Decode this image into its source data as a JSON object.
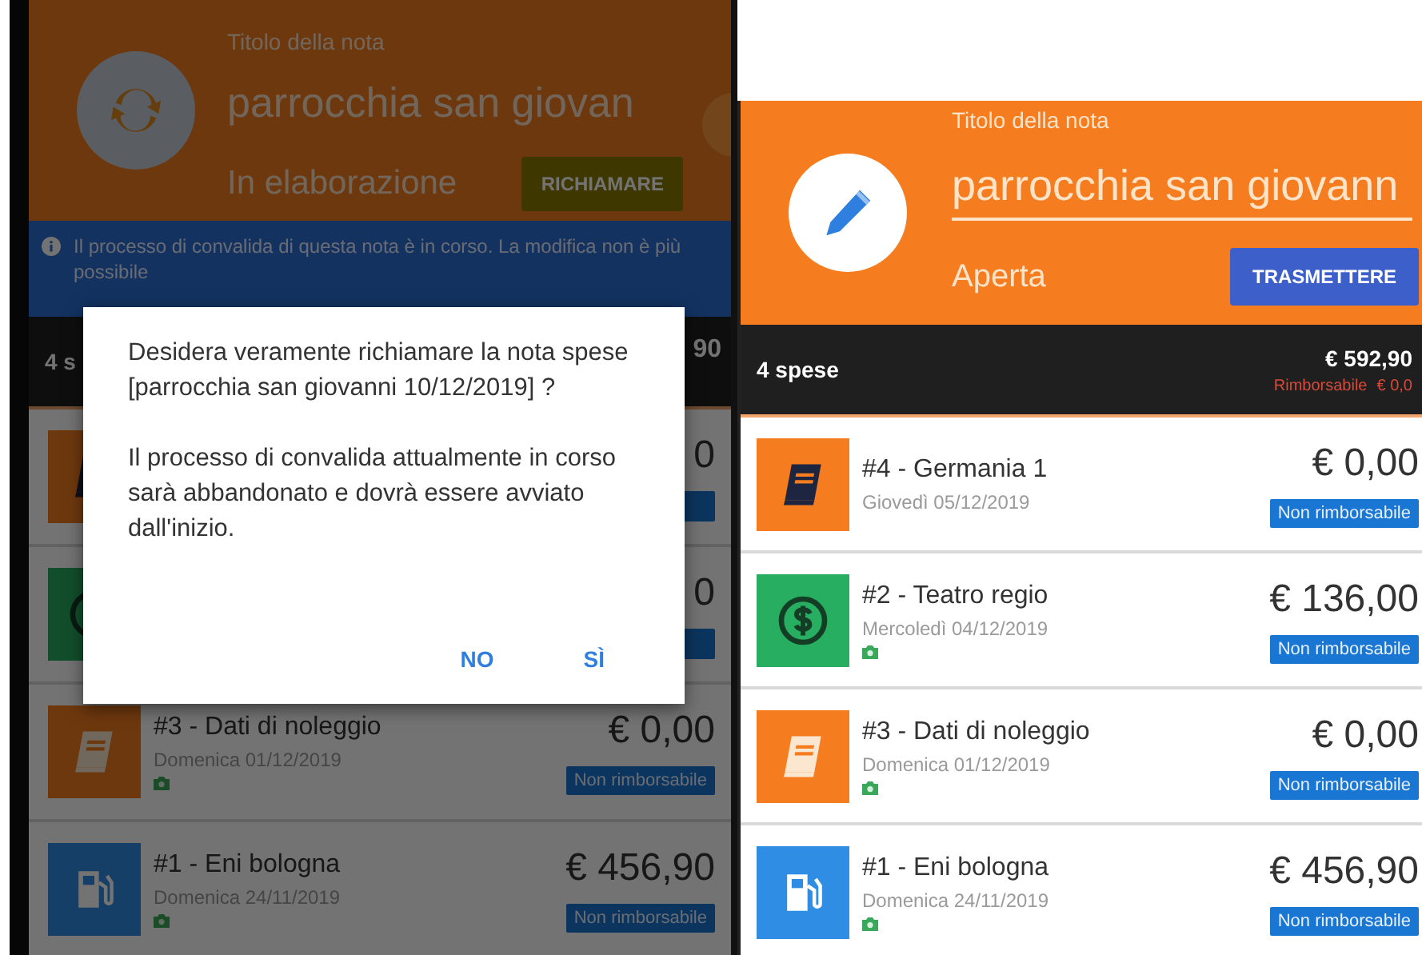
{
  "screens": [
    {
      "header": {
        "kind": "sync",
        "title_label": "Titolo della nota",
        "title": "parrocchia san giovan",
        "editable": false,
        "status": "In elaborazione",
        "action": {
          "label": "RICHIAMARE",
          "kind": "recall"
        },
        "fab": true
      },
      "banner": "Il processo di convalida di questa nota è in corso. La modifica non è più possibile",
      "summary": {
        "count": "4 s",
        "total": "90"
      },
      "expenses": [
        {
          "kind": "notebook",
          "amount": "0",
          "reimbursable": false
        },
        {
          "kind": "money",
          "amount": "0",
          "reimbursable": false
        },
        {
          "kind": "book",
          "title": "#3 - Dati di noleggio",
          "date": "Domenica 01/12/2019",
          "photo": true,
          "amount": "€ 0,00",
          "reimbursable": false,
          "badge": "Non rimborsabile"
        },
        {
          "kind": "fuel",
          "title": "#1 - Eni bologna",
          "date": "Domenica 24/11/2019",
          "photo": true,
          "amount": "€ 456,90",
          "reimbursable": false,
          "badge": "Non rimborsabile"
        }
      ],
      "dialog": {
        "message": "Desidera veramente richiamare la nota spese [parrocchia san giovanni 10/12/2019] ?",
        "detail": "Il processo di convalida attualmente in corso sarà abbandonato e dovrà essere avviato dall'inizio.",
        "buttons": [
          "NO",
          "SÌ"
        ]
      }
    },
    {
      "header": {
        "kind": "edit",
        "title_label": "Titolo della nota",
        "title": "parrocchia san giovann",
        "editable": true,
        "status": "Aperta",
        "action": {
          "label": "TRASMETTERE",
          "kind": "transmit"
        }
      },
      "summary": {
        "count": "4 spese",
        "total": "€ 592,90",
        "reimbursable_label": "Rimborsabile",
        "reimbursable_amount": "€ 0,0"
      },
      "expenses": [
        {
          "kind": "notebook",
          "title": "#4 - Germania 1",
          "date": "Giovedì 05/12/2019",
          "photo": false,
          "amount": "€ 0,00",
          "reimbursable": false,
          "badge": "Non rimborsabile"
        },
        {
          "kind": "money",
          "title": "#2 - Teatro regio",
          "date": "Mercoledì 04/12/2019",
          "photo": true,
          "amount": "€ 136,00",
          "reimbursable": false,
          "badge": "Non rimborsabile"
        },
        {
          "kind": "book",
          "title": "#3 - Dati di noleggio",
          "date": "Domenica 01/12/2019",
          "photo": true,
          "amount": "€ 0,00",
          "reimbursable": false,
          "badge": "Non rimborsabile"
        },
        {
          "kind": "fuel",
          "title": "#1 - Eni bologna",
          "date": "Domenica 24/11/2019",
          "photo": true,
          "amount": "€ 456,90",
          "reimbursable": false,
          "badge": "Non rimborsabile"
        }
      ]
    }
  ]
}
